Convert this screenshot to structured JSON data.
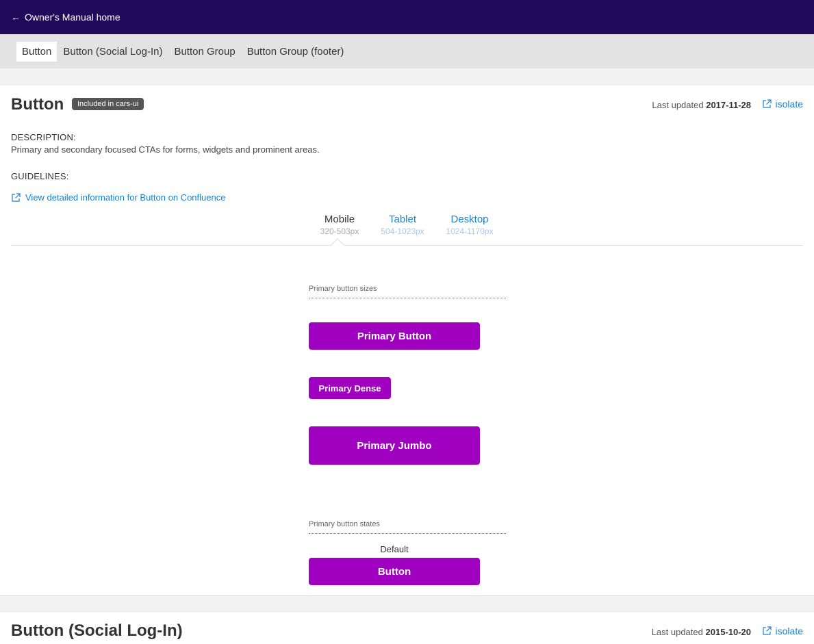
{
  "topbar": {
    "back_label": "Owner's Manual home"
  },
  "subnav": {
    "tabs": [
      {
        "label": "Button"
      },
      {
        "label": "Button (Social Log-In)"
      },
      {
        "label": "Button Group"
      },
      {
        "label": "Button Group (footer)"
      }
    ]
  },
  "component": {
    "title": "Button",
    "badge": "Included in cars-ui",
    "updated_prefix": "Last updated",
    "updated_date": "2017-11-28",
    "isolate_label": "isolate",
    "description_heading": "DESCRIPTION:",
    "description": "Primary and secondary focused CTAs for forms, widgets and prominent areas.",
    "guidelines_heading": "GUIDELINES:",
    "confluence_link": "View detailed information for Button on Confluence",
    "breakpoints": [
      {
        "name": "Mobile",
        "range": "320-503px"
      },
      {
        "name": "Tablet",
        "range": "504-1023px"
      },
      {
        "name": "Desktop",
        "range": "1024-1170px"
      }
    ],
    "sizes_label": "Primary button sizes",
    "sizes": [
      {
        "label": "Primary Button"
      },
      {
        "label": "Primary Dense"
      },
      {
        "label": "Primary Jumbo"
      }
    ],
    "states_label": "Primary button states",
    "states": [
      {
        "state": "Default",
        "label": "Button"
      }
    ]
  },
  "next_component": {
    "title": "Button (Social Log-In)",
    "updated_prefix": "Last updated",
    "updated_date": "2015-10-20",
    "isolate_label": "isolate"
  },
  "colors": {
    "header": "#220a5a",
    "primary": "#a000c0",
    "link": "#1a80d0"
  }
}
